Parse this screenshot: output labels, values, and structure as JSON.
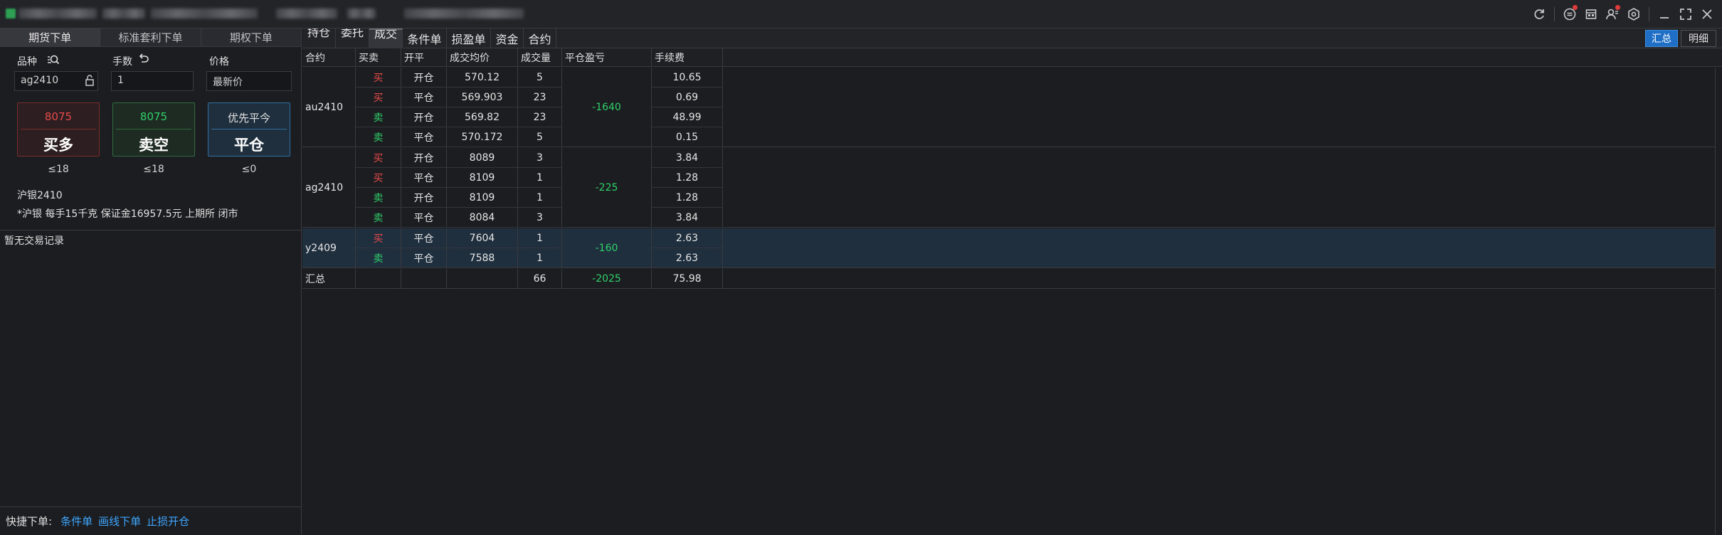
{
  "titlebar": {
    "icons": [
      "refresh-icon",
      "message-icon",
      "calendar-icon",
      "user-icon",
      "settings-icon",
      "minimize-icon",
      "maximize-icon",
      "close-icon"
    ]
  },
  "order_tabs": [
    "期货下单",
    "标准套利下单",
    "期权下单"
  ],
  "order": {
    "labels": {
      "product": "品种",
      "lots": "手数",
      "price": "价格"
    },
    "product_value": "ag2410",
    "lots_value": "1",
    "price_value": "最新价",
    "buy": {
      "price": "8075",
      "label": "买多",
      "limit": "≤18"
    },
    "sell": {
      "price": "8075",
      "label": "卖空",
      "limit": "≤18"
    },
    "close": {
      "hint": "优先平今",
      "label": "平仓",
      "limit": "≤0"
    },
    "product_name": "沪银2410",
    "product_info": "*沪银 每手15千克 保证金16957.5元 上期所 闭市",
    "no_trade": "暂无交易记录"
  },
  "quick": {
    "label": "快捷下单:",
    "links": [
      "条件单",
      "画线下单",
      "止损开仓"
    ]
  },
  "tabs": [
    "持仓",
    "委托",
    "成交",
    "条件单",
    "损盈单",
    "资金",
    "合约"
  ],
  "active_tab": 2,
  "view_buttons": {
    "summary": "汇总",
    "detail": "明细"
  },
  "columns": [
    "合约",
    "买卖",
    "开平",
    "成交均价",
    "成交量",
    "平仓盈亏",
    "手续费"
  ],
  "groups": [
    {
      "contract": "au2410",
      "pnl": "-1640",
      "rows": [
        {
          "side": "买",
          "dir": "buy",
          "oc": "开仓",
          "avg": "570.12",
          "vol": "5",
          "fee": "10.65"
        },
        {
          "side": "买",
          "dir": "buy",
          "oc": "平仓",
          "avg": "569.903",
          "vol": "23",
          "fee": "0.69"
        },
        {
          "side": "卖",
          "dir": "sell",
          "oc": "开仓",
          "avg": "569.82",
          "vol": "23",
          "fee": "48.99"
        },
        {
          "side": "卖",
          "dir": "sell",
          "oc": "平仓",
          "avg": "570.172",
          "vol": "5",
          "fee": "0.15"
        }
      ]
    },
    {
      "contract": "ag2410",
      "pnl": "-225",
      "rows": [
        {
          "side": "买",
          "dir": "buy",
          "oc": "开仓",
          "avg": "8089",
          "vol": "3",
          "fee": "3.84"
        },
        {
          "side": "买",
          "dir": "buy",
          "oc": "平仓",
          "avg": "8109",
          "vol": "1",
          "fee": "1.28"
        },
        {
          "side": "卖",
          "dir": "sell",
          "oc": "开仓",
          "avg": "8109",
          "vol": "1",
          "fee": "1.28"
        },
        {
          "side": "卖",
          "dir": "sell",
          "oc": "平仓",
          "avg": "8084",
          "vol": "3",
          "fee": "3.84"
        }
      ]
    },
    {
      "contract": "y2409",
      "pnl": "-160",
      "selected": true,
      "rows": [
        {
          "side": "买",
          "dir": "buy",
          "oc": "平仓",
          "avg": "7604",
          "vol": "1",
          "fee": "2.63"
        },
        {
          "side": "卖",
          "dir": "sell",
          "oc": "平仓",
          "avg": "7588",
          "vol": "1",
          "fee": "2.63"
        }
      ]
    }
  ],
  "summary": {
    "label": "汇总",
    "vol": "66",
    "pnl": "-2025",
    "fee": "75.98"
  },
  "colors": {
    "buy": "#e84a4a",
    "sell": "#2fd06a",
    "accent": "#1f6fc7",
    "link": "#3ea6ff"
  }
}
